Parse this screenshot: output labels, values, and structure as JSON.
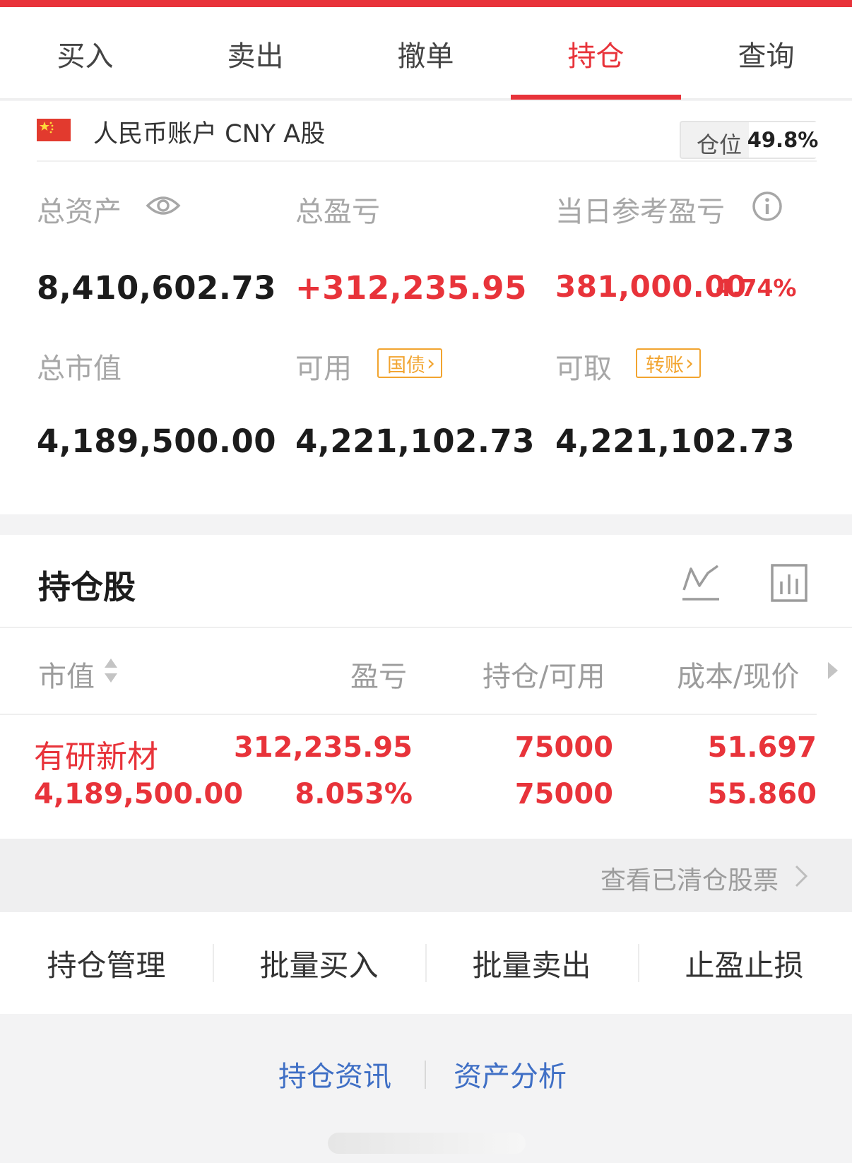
{
  "colors": {
    "accent": "#e8333a",
    "tag": "#f2a42f",
    "link": "#3f6fc5",
    "muted": "#a7a7a7"
  },
  "tabs": [
    {
      "label": "买入"
    },
    {
      "label": "卖出"
    },
    {
      "label": "撤单"
    },
    {
      "label": "持仓"
    },
    {
      "label": "查询"
    }
  ],
  "active_tab": "持仓",
  "account": {
    "flag_icon": "china-flag-icon",
    "label": "人民币账户 CNY A股",
    "position_label": "仓位",
    "position_value": "49.8%"
  },
  "summary": {
    "total_assets_label": "总资产",
    "total_assets_value": "8,410,602.73",
    "total_pnl_label": "总盈亏",
    "total_pnl_value": "+312,235.95",
    "daily_pnl_label": "当日参考盈亏",
    "daily_pnl_value": "381,000.00",
    "daily_pnl_pct": "4.74%",
    "market_value_label": "总市值",
    "market_value_value": "4,189,500.00",
    "available_label": "可用",
    "available_tag": "国债",
    "available_value": "4,221,102.73",
    "withdrawable_label": "可取",
    "withdrawable_tag": "转账",
    "withdrawable_value": "4,221,102.73"
  },
  "holdings": {
    "title": "持仓股",
    "columns": [
      "市值",
      "盈亏",
      "持仓/可用",
      "成本/现价"
    ],
    "rows": [
      {
        "name": "有研新材",
        "market_value": "4,189,500.00",
        "pnl": "312,235.95",
        "pnl_pct": "8.053%",
        "position": "75000",
        "available": "75000",
        "cost": "51.697",
        "price": "55.860"
      }
    ]
  },
  "cleared": {
    "label": "查看已清仓股票"
  },
  "actions": [
    "持仓管理",
    "批量买入",
    "批量卖出",
    "止盈止损"
  ],
  "footer_links": [
    "持仓资讯",
    "资产分析"
  ]
}
